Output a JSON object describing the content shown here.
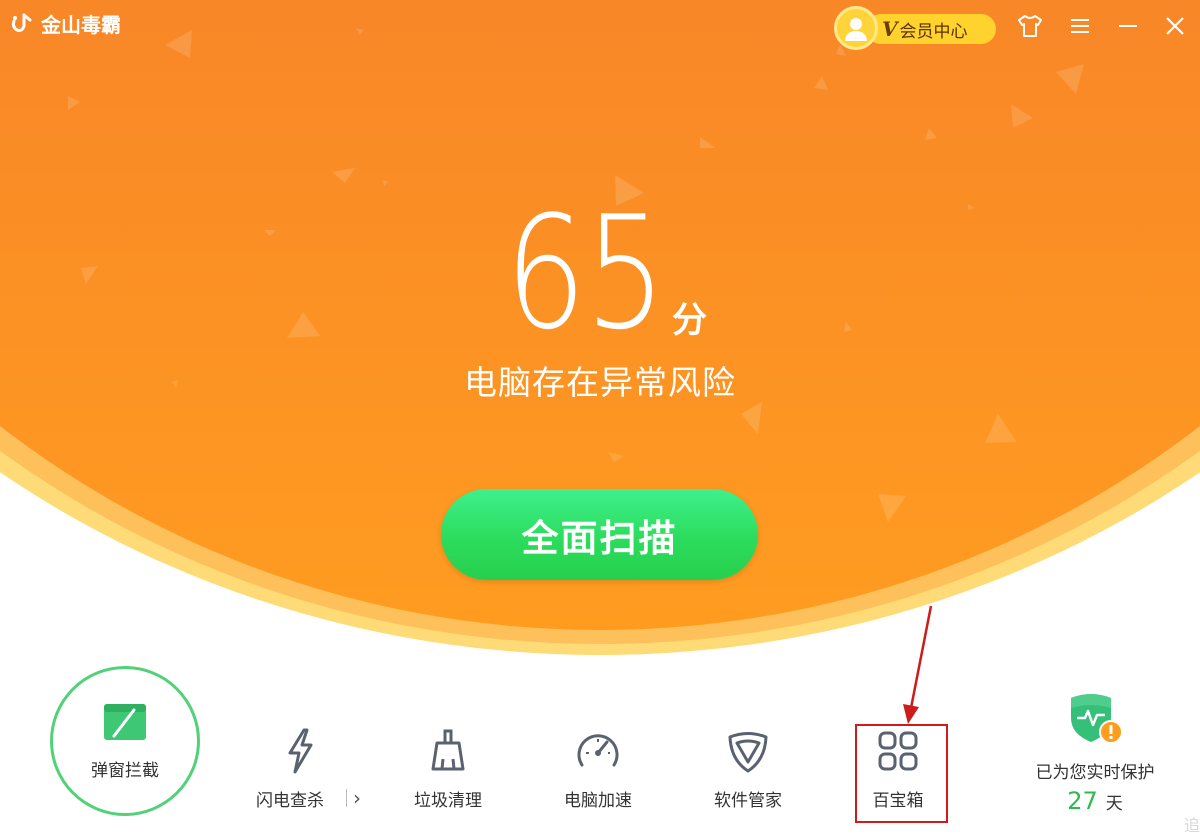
{
  "app": {
    "name": "金山毒霸"
  },
  "header": {
    "vip_label": "会员中心",
    "vip_badge": "V"
  },
  "score": {
    "value": "65",
    "unit": "分",
    "status": "电脑存在异常风险"
  },
  "scan_button": {
    "label": "全面扫描"
  },
  "toolbar": {
    "popup_block": {
      "label": "弹窗拦截"
    },
    "items": [
      {
        "label": "闪电查杀",
        "icon": "lightning-icon"
      },
      {
        "label": "垃圾清理",
        "icon": "broom-icon"
      },
      {
        "label": "电脑加速",
        "icon": "speedometer-icon"
      },
      {
        "label": "软件管家",
        "icon": "shield-v-icon"
      },
      {
        "label": "百宝箱",
        "icon": "grid-icon"
      }
    ],
    "flash_more": "›"
  },
  "protection": {
    "text": "已为您实时保护",
    "days": "27",
    "unit": "天"
  },
  "edge_text": "追",
  "colors": {
    "orange_top": "#ec6233",
    "orange_bottom": "#fe9a22",
    "rim": "#fedb76",
    "scan_green": "#2ddc5e",
    "accent_green": "#52d178",
    "highlight_red": "#cc1c1c"
  }
}
